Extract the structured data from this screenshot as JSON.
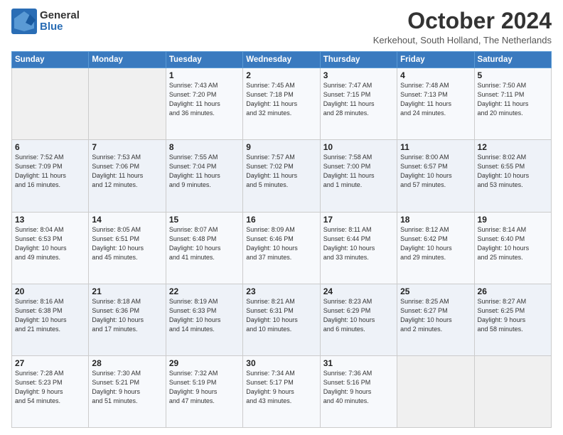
{
  "logo": {
    "general": "General",
    "blue": "Blue"
  },
  "header": {
    "month": "October 2024",
    "location": "Kerkehout, South Holland, The Netherlands"
  },
  "days_of_week": [
    "Sunday",
    "Monday",
    "Tuesday",
    "Wednesday",
    "Thursday",
    "Friday",
    "Saturday"
  ],
  "weeks": [
    [
      {
        "day": "",
        "info": ""
      },
      {
        "day": "",
        "info": ""
      },
      {
        "day": "1",
        "info": "Sunrise: 7:43 AM\nSunset: 7:20 PM\nDaylight: 11 hours\nand 36 minutes."
      },
      {
        "day": "2",
        "info": "Sunrise: 7:45 AM\nSunset: 7:18 PM\nDaylight: 11 hours\nand 32 minutes."
      },
      {
        "day": "3",
        "info": "Sunrise: 7:47 AM\nSunset: 7:15 PM\nDaylight: 11 hours\nand 28 minutes."
      },
      {
        "day": "4",
        "info": "Sunrise: 7:48 AM\nSunset: 7:13 PM\nDaylight: 11 hours\nand 24 minutes."
      },
      {
        "day": "5",
        "info": "Sunrise: 7:50 AM\nSunset: 7:11 PM\nDaylight: 11 hours\nand 20 minutes."
      }
    ],
    [
      {
        "day": "6",
        "info": "Sunrise: 7:52 AM\nSunset: 7:09 PM\nDaylight: 11 hours\nand 16 minutes."
      },
      {
        "day": "7",
        "info": "Sunrise: 7:53 AM\nSunset: 7:06 PM\nDaylight: 11 hours\nand 12 minutes."
      },
      {
        "day": "8",
        "info": "Sunrise: 7:55 AM\nSunset: 7:04 PM\nDaylight: 11 hours\nand 9 minutes."
      },
      {
        "day": "9",
        "info": "Sunrise: 7:57 AM\nSunset: 7:02 PM\nDaylight: 11 hours\nand 5 minutes."
      },
      {
        "day": "10",
        "info": "Sunrise: 7:58 AM\nSunset: 7:00 PM\nDaylight: 11 hours\nand 1 minute."
      },
      {
        "day": "11",
        "info": "Sunrise: 8:00 AM\nSunset: 6:57 PM\nDaylight: 10 hours\nand 57 minutes."
      },
      {
        "day": "12",
        "info": "Sunrise: 8:02 AM\nSunset: 6:55 PM\nDaylight: 10 hours\nand 53 minutes."
      }
    ],
    [
      {
        "day": "13",
        "info": "Sunrise: 8:04 AM\nSunset: 6:53 PM\nDaylight: 10 hours\nand 49 minutes."
      },
      {
        "day": "14",
        "info": "Sunrise: 8:05 AM\nSunset: 6:51 PM\nDaylight: 10 hours\nand 45 minutes."
      },
      {
        "day": "15",
        "info": "Sunrise: 8:07 AM\nSunset: 6:48 PM\nDaylight: 10 hours\nand 41 minutes."
      },
      {
        "day": "16",
        "info": "Sunrise: 8:09 AM\nSunset: 6:46 PM\nDaylight: 10 hours\nand 37 minutes."
      },
      {
        "day": "17",
        "info": "Sunrise: 8:11 AM\nSunset: 6:44 PM\nDaylight: 10 hours\nand 33 minutes."
      },
      {
        "day": "18",
        "info": "Sunrise: 8:12 AM\nSunset: 6:42 PM\nDaylight: 10 hours\nand 29 minutes."
      },
      {
        "day": "19",
        "info": "Sunrise: 8:14 AM\nSunset: 6:40 PM\nDaylight: 10 hours\nand 25 minutes."
      }
    ],
    [
      {
        "day": "20",
        "info": "Sunrise: 8:16 AM\nSunset: 6:38 PM\nDaylight: 10 hours\nand 21 minutes."
      },
      {
        "day": "21",
        "info": "Sunrise: 8:18 AM\nSunset: 6:36 PM\nDaylight: 10 hours\nand 17 minutes."
      },
      {
        "day": "22",
        "info": "Sunrise: 8:19 AM\nSunset: 6:33 PM\nDaylight: 10 hours\nand 14 minutes."
      },
      {
        "day": "23",
        "info": "Sunrise: 8:21 AM\nSunset: 6:31 PM\nDaylight: 10 hours\nand 10 minutes."
      },
      {
        "day": "24",
        "info": "Sunrise: 8:23 AM\nSunset: 6:29 PM\nDaylight: 10 hours\nand 6 minutes."
      },
      {
        "day": "25",
        "info": "Sunrise: 8:25 AM\nSunset: 6:27 PM\nDaylight: 10 hours\nand 2 minutes."
      },
      {
        "day": "26",
        "info": "Sunrise: 8:27 AM\nSunset: 6:25 PM\nDaylight: 9 hours\nand 58 minutes."
      }
    ],
    [
      {
        "day": "27",
        "info": "Sunrise: 7:28 AM\nSunset: 5:23 PM\nDaylight: 9 hours\nand 54 minutes."
      },
      {
        "day": "28",
        "info": "Sunrise: 7:30 AM\nSunset: 5:21 PM\nDaylight: 9 hours\nand 51 minutes."
      },
      {
        "day": "29",
        "info": "Sunrise: 7:32 AM\nSunset: 5:19 PM\nDaylight: 9 hours\nand 47 minutes."
      },
      {
        "day": "30",
        "info": "Sunrise: 7:34 AM\nSunset: 5:17 PM\nDaylight: 9 hours\nand 43 minutes."
      },
      {
        "day": "31",
        "info": "Sunrise: 7:36 AM\nSunset: 5:16 PM\nDaylight: 9 hours\nand 40 minutes."
      },
      {
        "day": "",
        "info": ""
      },
      {
        "day": "",
        "info": ""
      }
    ]
  ]
}
